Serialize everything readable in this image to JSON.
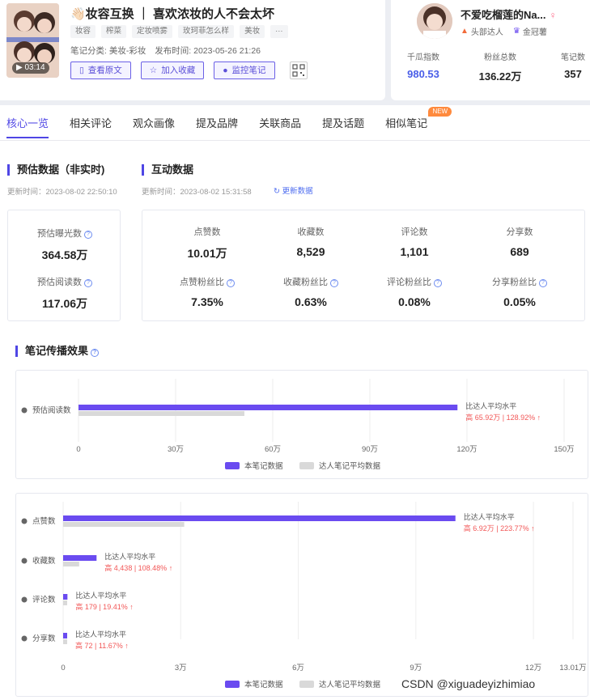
{
  "note": {
    "title": "👋🏻妆容互换 ｜ 喜欢浓妆的人不会太坏",
    "duration": "03:14",
    "tags": [
      "妆容",
      "榨菜",
      "定妆喷雾",
      "玫珂菲怎么样",
      "美妆",
      "···"
    ],
    "category": "笔记分类: 美妆-彩妆",
    "publish_time": "发布时间: 2023-05-26 21:26",
    "buttons": {
      "view": "查看原文",
      "collect": "加入收藏",
      "monitor": "监控笔记"
    }
  },
  "author": {
    "name": "不爱吃榴莲的Na...",
    "gender_symbol": "♀",
    "badge1": "头部达人",
    "badge2": "金冠薯",
    "stats": [
      {
        "label": "千瓜指数",
        "value": "980.53"
      },
      {
        "label": "粉丝总数",
        "value": "136.22万"
      },
      {
        "label": "笔记数",
        "value": "357"
      }
    ]
  },
  "tabs": [
    "核心一览",
    "相关评论",
    "观众画像",
    "提及品牌",
    "关联商品",
    "提及话题",
    "相似笔记"
  ],
  "new_badge": "NEW",
  "estimate": {
    "title": "预估数据（非实时)",
    "updated": "更新时间：2023-08-02 22:50:10",
    "exposure_label": "预估曝光数",
    "exposure_value": "364.58万",
    "reads_label": "预估阅读数",
    "reads_value": "117.06万"
  },
  "interaction": {
    "title": "互动数据",
    "updated": "更新时间：2023-08-02 15:31:58",
    "refresh": "更新数据",
    "metrics": [
      {
        "label": "点赞数",
        "value": "10.01万"
      },
      {
        "label": "收藏数",
        "value": "8,529"
      },
      {
        "label": "评论数",
        "value": "1,101"
      },
      {
        "label": "分享数",
        "value": "689"
      }
    ],
    "ratios": [
      {
        "label": "点赞粉丝比",
        "value": "7.35%"
      },
      {
        "label": "收藏粉丝比",
        "value": "0.63%"
      },
      {
        "label": "评论粉丝比",
        "value": "0.08%"
      },
      {
        "label": "分享粉丝比",
        "value": "0.05%"
      }
    ]
  },
  "spread": {
    "title": "笔记传播效果"
  },
  "colors": {
    "primary": "#6a4bf0",
    "avg": "#d9d9d9",
    "up": "#f25757"
  },
  "chart_data": [
    {
      "type": "bar",
      "orientation": "horizontal",
      "categories": [
        "预估阅读数"
      ],
      "series": [
        {
          "name": "本笔记数据",
          "values": [
            1170600
          ]
        },
        {
          "name": "达人笔记平均数据",
          "values": [
            512400
          ]
        }
      ],
      "xlim": [
        0,
        1500000
      ],
      "ticks": [
        "0",
        "30万",
        "60万",
        "90万",
        "120万",
        "150万"
      ],
      "tick_values": [
        0,
        300000,
        600000,
        900000,
        1200000,
        1500000
      ],
      "annotations": [
        {
          "label": "比达人平均水平",
          "detail": "高 65.92万 | 128.92% ↑"
        }
      ],
      "legend": "bottom"
    },
    {
      "type": "bar",
      "orientation": "horizontal",
      "categories": [
        "点赞数",
        "收藏数",
        "评论数",
        "分享数"
      ],
      "series": [
        {
          "name": "本笔记数据",
          "values": [
            100100,
            8529,
            1101,
            689
          ]
        },
        {
          "name": "达人笔记平均数据",
          "values": [
            30900,
            4091,
            922,
            617
          ]
        }
      ],
      "xlim": [
        0,
        130100
      ],
      "ticks": [
        "0",
        "3万",
        "6万",
        "9万",
        "12万",
        "13.01万"
      ],
      "tick_values": [
        0,
        30000,
        60000,
        90000,
        120000,
        130100
      ],
      "annotations": [
        {
          "label": "比达人平均水平",
          "detail": "高 6.92万 | 223.77% ↑"
        },
        {
          "label": "比达人平均水平",
          "detail": "高 4,438 | 108.48% ↑"
        },
        {
          "label": "比达人平均水平",
          "detail": "高 179 | 19.41% ↑"
        },
        {
          "label": "比达人平均水平",
          "detail": "高 72 | 11.67% ↑"
        }
      ],
      "legend": "bottom"
    }
  ],
  "watermark": "CSDN @xiguadeyizhimiao"
}
